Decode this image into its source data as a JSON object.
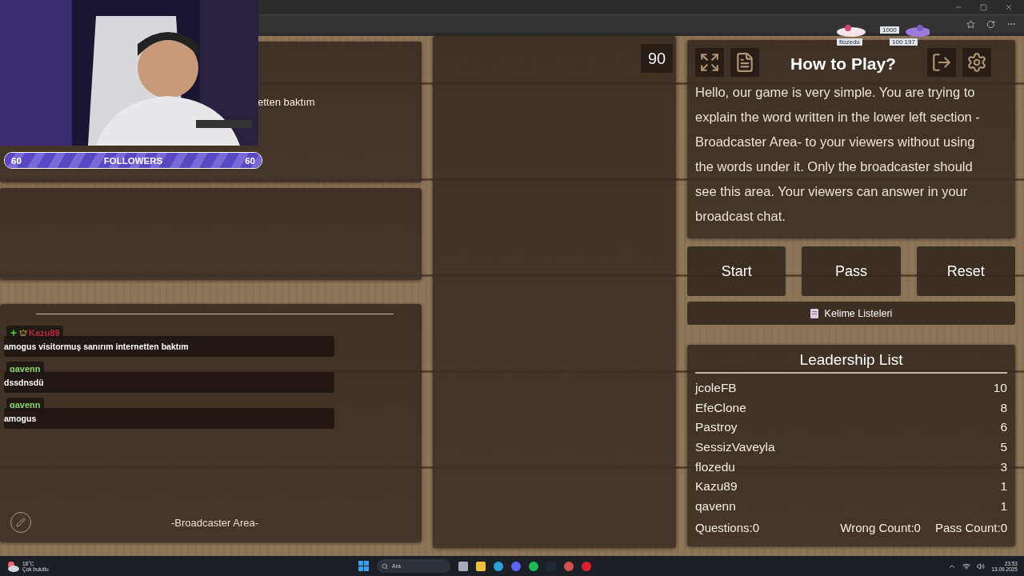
{
  "followers_bar": {
    "start": "60",
    "label": "FOLLOWERS",
    "end": "60",
    "level": 1
  },
  "top_panel": {
    "text": "etten baktım"
  },
  "chat": {
    "messages": [
      {
        "user": "Kazu89",
        "color": "#b8283a",
        "kind": "badged",
        "text": "amogus visitormuş sanırım internetten baktım"
      },
      {
        "user": "qavenn",
        "color": "#8fd46a",
        "kind": "plain",
        "text": "dssdnsdü"
      },
      {
        "user": "qavenn",
        "color": "#8fd46a",
        "kind": "plain",
        "text": "amogus"
      }
    ]
  },
  "broadcaster_label": "-Broadcaster Area-",
  "timer": "90",
  "stream_overlay": {
    "name": "flozedu",
    "count": "1000",
    "stats": "100 197"
  },
  "how_to_play": {
    "title": "How to Play?",
    "text": "Hello, our game is very simple. You are trying to explain the word written in the lower left section -Broadcaster Area- to your viewers without using the words under it. Only the broadcaster should see this area. Your viewers can answer in your broadcast chat."
  },
  "buttons": [
    "Start",
    "Pass",
    "Reset"
  ],
  "word_lists_button": "Kelime Listeleri",
  "leaderboard": {
    "title": "Leadership List",
    "rows": [
      {
        "name": "jcoleFB",
        "score": "10"
      },
      {
        "name": "EfeClone",
        "score": "8"
      },
      {
        "name": "Pastroy",
        "score": "6"
      },
      {
        "name": "SessizVaveyla",
        "score": "5"
      },
      {
        "name": "flozedu",
        "score": "3"
      },
      {
        "name": "Kazu89",
        "score": "1"
      },
      {
        "name": "qavenn",
        "score": "1"
      }
    ],
    "stats": [
      "Questions:0",
      "Wrong Count:0",
      "Pass Count:0"
    ]
  },
  "taskbar": {
    "weather": {
      "temperature": "18°C",
      "condition": "Çok bulutlu"
    },
    "search": {
      "placeholder": "Ara"
    },
    "clock": {
      "time": "23:53",
      "date": "13.09.2025"
    }
  }
}
